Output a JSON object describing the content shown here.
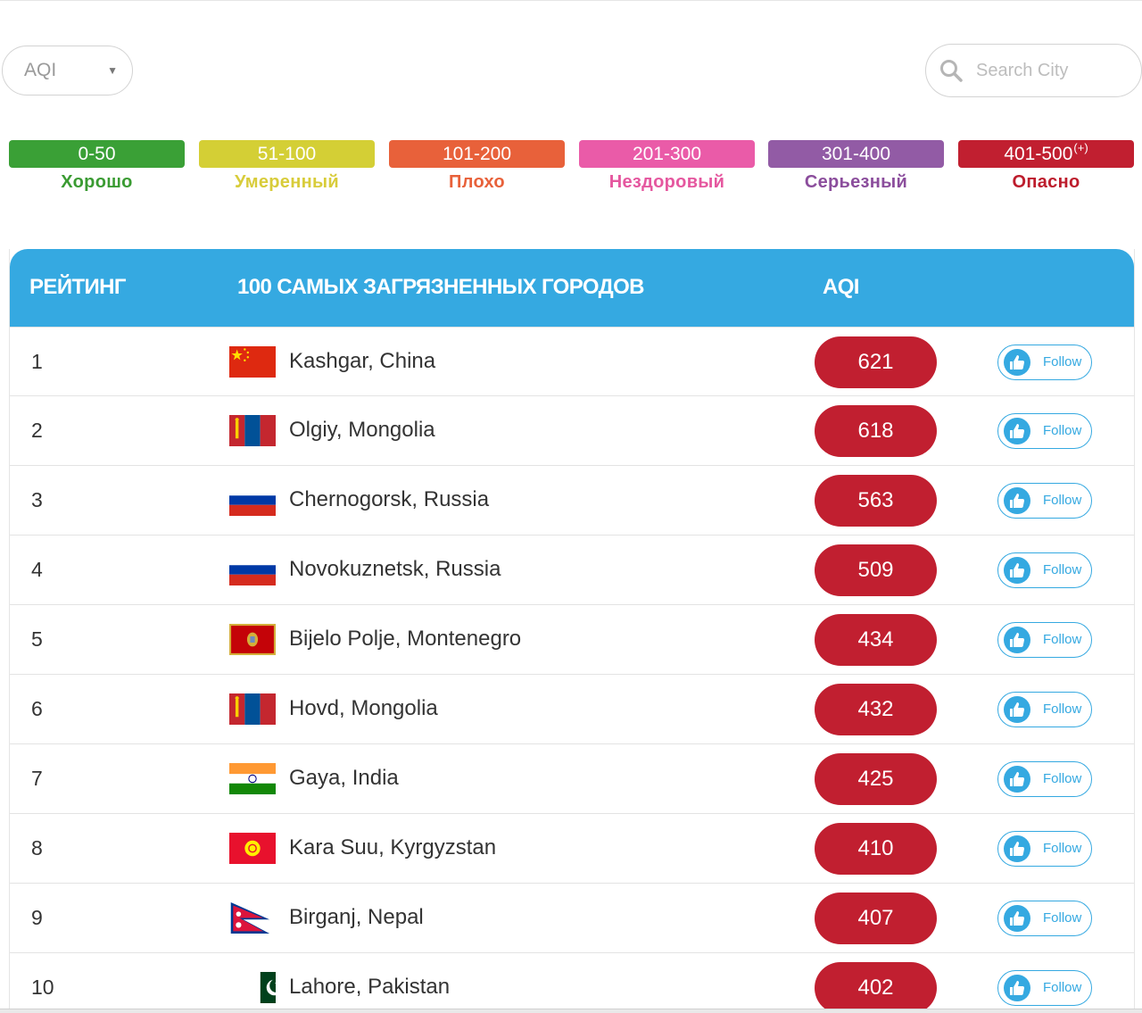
{
  "filter": {
    "selected": "AQI"
  },
  "search": {
    "placeholder": "Search City"
  },
  "scale": [
    {
      "range": "0-50",
      "label": "Хорошо",
      "color": "#3aa036",
      "label_color": "#3a9b32"
    },
    {
      "range": "51-100",
      "label": "Умеренный",
      "color": "#d4cf35",
      "label_color": "#d8cc3a"
    },
    {
      "range": "101-200",
      "label": "Плохо",
      "color": "#e8613a",
      "label_color": "#e8613a"
    },
    {
      "range": "201-300",
      "label": "Нездоровый",
      "color": "#ea5ba8",
      "label_color": "#e5579f"
    },
    {
      "range": "301-400",
      "label": "Серьезный",
      "color": "#925ba5",
      "label_color": "#8b4d9c"
    },
    {
      "range": "401-500",
      "sup": "(+)",
      "label": "Опасно",
      "color": "#c11f30",
      "label_color": "#bd1c2c"
    }
  ],
  "table": {
    "headers": {
      "rank": "РЕЙТИНГ",
      "city": "100 САМЫХ ЗАГРЯЗНЕННЫХ ГОРОДОВ",
      "aqi": "AQI"
    },
    "follow_label": "Follow",
    "rows": [
      {
        "rank": "1",
        "city": "Kashgar, China",
        "aqi": "621",
        "flag": "china"
      },
      {
        "rank": "2",
        "city": "Olgiy, Mongolia",
        "aqi": "618",
        "flag": "mongolia"
      },
      {
        "rank": "3",
        "city": "Chernogorsk, Russia",
        "aqi": "563",
        "flag": "russia"
      },
      {
        "rank": "4",
        "city": "Novokuznetsk, Russia",
        "aqi": "509",
        "flag": "russia"
      },
      {
        "rank": "5",
        "city": "Bijelo Polje, Montenegro",
        "aqi": "434",
        "flag": "montenegro"
      },
      {
        "rank": "6",
        "city": "Hovd, Mongolia",
        "aqi": "432",
        "flag": "mongolia"
      },
      {
        "rank": "7",
        "city": "Gaya, India",
        "aqi": "425",
        "flag": "india"
      },
      {
        "rank": "8",
        "city": "Kara Suu, Kyrgyzstan",
        "aqi": "410",
        "flag": "kyrgyzstan"
      },
      {
        "rank": "9",
        "city": "Birganj, Nepal",
        "aqi": "407",
        "flag": "nepal"
      },
      {
        "rank": "10",
        "city": "Lahore, Pakistan",
        "aqi": "402",
        "flag": "pakistan"
      }
    ]
  }
}
